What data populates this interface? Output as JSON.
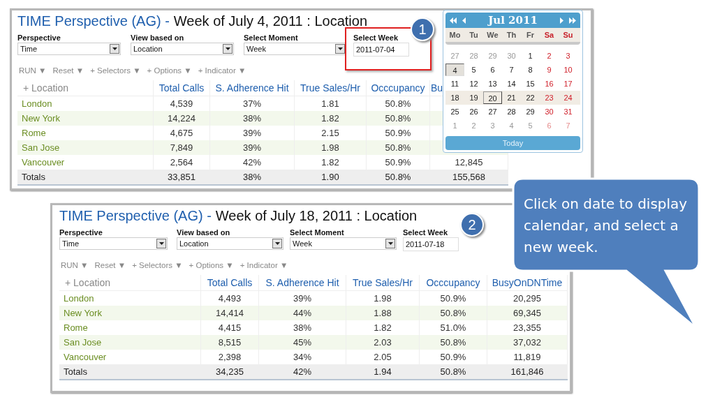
{
  "panels": [
    {
      "title": "TIME Perspective (AG) -",
      "subtitle": "Week of July 4, 2011 : Location",
      "badge": "1",
      "selectors": [
        {
          "label": "Perspective",
          "value": "Time",
          "kind": "dropdown",
          "highlighted": false
        },
        {
          "label": "View based on",
          "value": "Location",
          "kind": "dropdown",
          "highlighted": false
        },
        {
          "label": "Select Moment",
          "value": "Week",
          "kind": "dropdown",
          "highlighted": false
        },
        {
          "label": "Select Week",
          "value": "2011-07-04",
          "kind": "date",
          "highlighted": true
        }
      ],
      "toolbar": [
        "RUN ▼",
        "Reset ▼",
        "+ Selectors ▼",
        "+ Options ▼",
        "+ Indicator ▼"
      ],
      "table": {
        "columns": [
          "+ Location",
          "Total Calls",
          "S. Adherence Hit",
          "True Sales/Hr",
          "Occcupancy",
          "Bu"
        ],
        "rows": [
          {
            "kind": "data",
            "cells": [
              "London",
              "4,539",
              "37%",
              "1.81",
              "50.8%"
            ]
          },
          {
            "kind": "data",
            "cells": [
              "New York",
              "14,224",
              "38%",
              "1.82",
              "50.8%"
            ]
          },
          {
            "kind": "data",
            "cells": [
              "Rome",
              "4,675",
              "39%",
              "2.15",
              "50.9%"
            ]
          },
          {
            "kind": "data",
            "cells": [
              "San Jose",
              "7,849",
              "39%",
              "1.98",
              "50.8%"
            ]
          },
          {
            "kind": "data",
            "cells": [
              "Vancouver",
              "2,564",
              "42%",
              "1.82",
              "50.9%",
              "12,845"
            ]
          },
          {
            "kind": "totals",
            "cells": [
              "Totals",
              "33,851",
              "38%",
              "1.90",
              "50.8%",
              "155,568"
            ]
          }
        ]
      },
      "calendar": {
        "month": "Jul 2011",
        "weekdays": [
          {
            "label": "Mo",
            "weekend": false
          },
          {
            "label": "Tu",
            "weekend": false
          },
          {
            "label": "We",
            "weekend": false
          },
          {
            "label": "Th",
            "weekend": false
          },
          {
            "label": "Fr",
            "weekend": false
          },
          {
            "label": "Sa",
            "weekend": true
          },
          {
            "label": "Su",
            "weekend": true
          }
        ],
        "weeks": [
          {
            "highlighted": false,
            "days": [
              {
                "label": "27",
                "outside": true,
                "weekend": false,
                "selected": false,
                "today": false
              },
              {
                "label": "28",
                "outside": true,
                "weekend": false,
                "selected": false,
                "today": false
              },
              {
                "label": "29",
                "outside": true,
                "weekend": false,
                "selected": false,
                "today": false
              },
              {
                "label": "30",
                "outside": true,
                "weekend": false,
                "selected": false,
                "today": false
              },
              {
                "label": "1",
                "outside": false,
                "weekend": false,
                "selected": false,
                "today": false
              },
              {
                "label": "2",
                "outside": false,
                "weekend": true,
                "selected": false,
                "today": false
              },
              {
                "label": "3",
                "outside": false,
                "weekend": true,
                "selected": false,
                "today": false
              }
            ]
          },
          {
            "highlighted": false,
            "days": [
              {
                "label": "4",
                "outside": false,
                "weekend": false,
                "selected": true,
                "today": false
              },
              {
                "label": "5",
                "outside": false,
                "weekend": false,
                "selected": false,
                "today": false
              },
              {
                "label": "6",
                "outside": false,
                "weekend": false,
                "selected": false,
                "today": false
              },
              {
                "label": "7",
                "outside": false,
                "weekend": false,
                "selected": false,
                "today": false
              },
              {
                "label": "8",
                "outside": false,
                "weekend": false,
                "selected": false,
                "today": false
              },
              {
                "label": "9",
                "outside": false,
                "weekend": true,
                "selected": false,
                "today": false
              },
              {
                "label": "10",
                "outside": false,
                "weekend": true,
                "selected": false,
                "today": false
              }
            ]
          },
          {
            "highlighted": false,
            "days": [
              {
                "label": "11",
                "outside": false,
                "weekend": false,
                "selected": false,
                "today": false
              },
              {
                "label": "12",
                "outside": false,
                "weekend": false,
                "selected": false,
                "today": false
              },
              {
                "label": "13",
                "outside": false,
                "weekend": false,
                "selected": false,
                "today": false
              },
              {
                "label": "14",
                "outside": false,
                "weekend": false,
                "selected": false,
                "today": false
              },
              {
                "label": "15",
                "outside": false,
                "weekend": false,
                "selected": false,
                "today": false
              },
              {
                "label": "16",
                "outside": false,
                "weekend": true,
                "selected": false,
                "today": false
              },
              {
                "label": "17",
                "outside": false,
                "weekend": true,
                "selected": false,
                "today": false
              }
            ]
          },
          {
            "highlighted": true,
            "days": [
              {
                "label": "18",
                "outside": false,
                "weekend": false,
                "selected": false,
                "today": false
              },
              {
                "label": "19",
                "outside": false,
                "weekend": false,
                "selected": false,
                "today": false
              },
              {
                "label": "20",
                "outside": false,
                "weekend": false,
                "selected": false,
                "today": true
              },
              {
                "label": "21",
                "outside": false,
                "weekend": false,
                "selected": false,
                "today": false
              },
              {
                "label": "22",
                "outside": false,
                "weekend": false,
                "selected": false,
                "today": false
              },
              {
                "label": "23",
                "outside": false,
                "weekend": true,
                "selected": false,
                "today": false
              },
              {
                "label": "24",
                "outside": false,
                "weekend": true,
                "selected": false,
                "today": false
              }
            ]
          },
          {
            "highlighted": false,
            "days": [
              {
                "label": "25",
                "outside": false,
                "weekend": false,
                "selected": false,
                "today": false
              },
              {
                "label": "26",
                "outside": false,
                "weekend": false,
                "selected": false,
                "today": false
              },
              {
                "label": "27",
                "outside": false,
                "weekend": false,
                "selected": false,
                "today": false
              },
              {
                "label": "28",
                "outside": false,
                "weekend": false,
                "selected": false,
                "today": false
              },
              {
                "label": "29",
                "outside": false,
                "weekend": false,
                "selected": false,
                "today": false
              },
              {
                "label": "30",
                "outside": false,
                "weekend": true,
                "selected": false,
                "today": false
              },
              {
                "label": "31",
                "outside": false,
                "weekend": true,
                "selected": false,
                "today": false
              }
            ]
          },
          {
            "highlighted": false,
            "days": [
              {
                "label": "1",
                "outside": true,
                "weekend": false,
                "selected": false,
                "today": false
              },
              {
                "label": "2",
                "outside": true,
                "weekend": false,
                "selected": false,
                "today": false
              },
              {
                "label": "3",
                "outside": true,
                "weekend": false,
                "selected": false,
                "today": false
              },
              {
                "label": "4",
                "outside": true,
                "weekend": false,
                "selected": false,
                "today": false
              },
              {
                "label": "5",
                "outside": true,
                "weekend": false,
                "selected": false,
                "today": false
              },
              {
                "label": "6",
                "outside": true,
                "weekend": true,
                "selected": false,
                "today": false
              },
              {
                "label": "7",
                "outside": true,
                "weekend": true,
                "selected": false,
                "today": false
              }
            ]
          }
        ],
        "today_button": "Today"
      }
    },
    {
      "title": "TIME Perspective (AG) -",
      "subtitle": "Week of July 18, 2011 : Location",
      "badge": "2",
      "selectors": [
        {
          "label": "Perspective",
          "value": "Time",
          "kind": "dropdown",
          "highlighted": false
        },
        {
          "label": "View based on",
          "value": "Location",
          "kind": "dropdown",
          "highlighted": false
        },
        {
          "label": "Select Moment",
          "value": "Week",
          "kind": "dropdown",
          "highlighted": false
        },
        {
          "label": "Select Week",
          "value": "2011-07-18",
          "kind": "date",
          "highlighted": false
        }
      ],
      "toolbar": [
        "RUN ▼",
        "Reset ▼",
        "+ Selectors ▼",
        "+ Options ▼",
        "+ Indicator ▼"
      ],
      "table": {
        "columns": [
          "+ Location",
          "Total Calls",
          "S. Adherence Hit",
          "True Sales/Hr",
          "Occcupancy",
          "BusyOnDNTime"
        ],
        "rows": [
          {
            "kind": "data",
            "cells": [
              "London",
              "4,493",
              "39%",
              "1.98",
              "50.9%",
              "20,295"
            ]
          },
          {
            "kind": "data",
            "cells": [
              "New York",
              "14,414",
              "44%",
              "1.88",
              "50.8%",
              "69,345"
            ]
          },
          {
            "kind": "data",
            "cells": [
              "Rome",
              "4,415",
              "38%",
              "1.82",
              "51.0%",
              "23,355"
            ]
          },
          {
            "kind": "data",
            "cells": [
              "San Jose",
              "8,515",
              "45%",
              "2.03",
              "50.8%",
              "37,032"
            ]
          },
          {
            "kind": "data",
            "cells": [
              "Vancouver",
              "2,398",
              "34%",
              "2.05",
              "50.9%",
              "11,819"
            ]
          },
          {
            "kind": "totals",
            "cells": [
              "Totals",
              "34,235",
              "42%",
              "1.94",
              "50.8%",
              "161,846"
            ]
          }
        ]
      }
    }
  ],
  "callout": {
    "text": "Click on date to display calendar, and select a new week."
  }
}
